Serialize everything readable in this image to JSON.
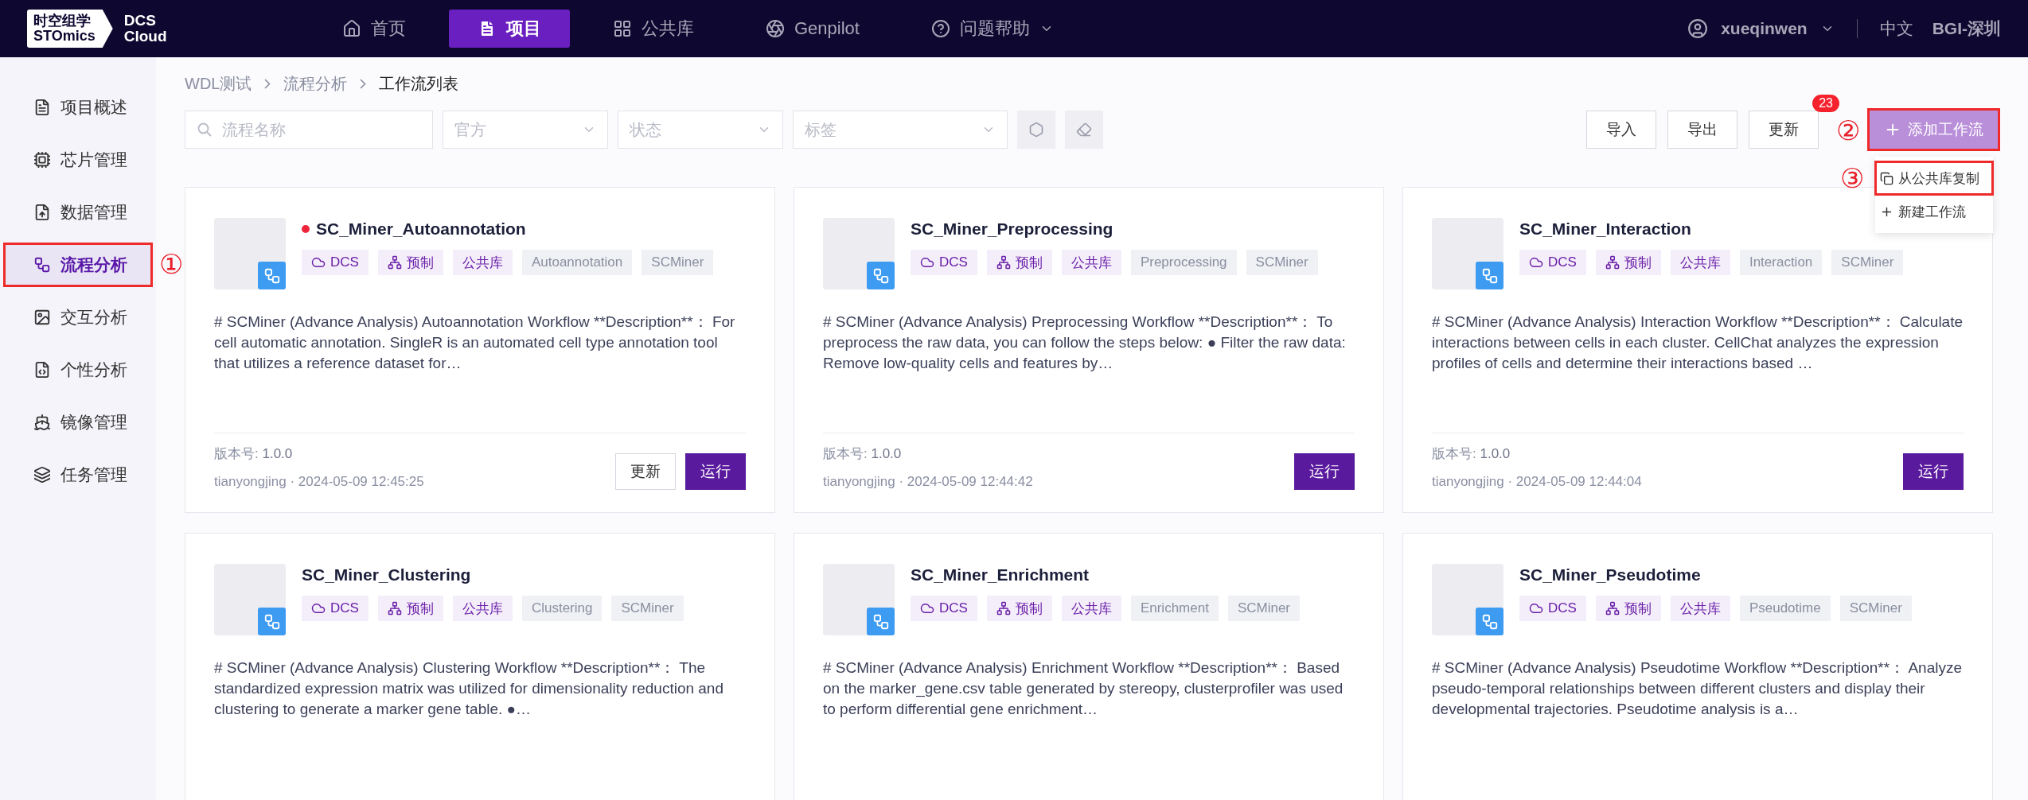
{
  "header": {
    "logo": {
      "brand_line1": "时空组学",
      "brand_line2": "STOmics",
      "product_line1": "DCS",
      "product_line2": "Cloud"
    },
    "nav": [
      {
        "label": "首页",
        "kind": "home",
        "selected": false,
        "dropdown": false
      },
      {
        "label": "项目",
        "kind": "project",
        "selected": true,
        "dropdown": false
      },
      {
        "label": "公共库",
        "kind": "library",
        "selected": false,
        "dropdown": false
      },
      {
        "label": "Genpilot",
        "kind": "genpilot",
        "selected": false,
        "dropdown": false
      },
      {
        "label": "问题帮助",
        "kind": "help",
        "selected": false,
        "dropdown": true
      }
    ],
    "user": "xueqinwen",
    "language": "中文",
    "region": "BGI-深圳"
  },
  "sidebar": {
    "items": [
      {
        "label": "项目概述",
        "kind": "overview",
        "selected": false,
        "highlighted": false
      },
      {
        "label": "芯片管理",
        "kind": "chip",
        "selected": false,
        "highlighted": false
      },
      {
        "label": "数据管理",
        "kind": "data",
        "selected": false,
        "highlighted": false
      },
      {
        "label": "流程分析",
        "kind": "workflow",
        "selected": true,
        "highlighted": true,
        "marker": "①"
      },
      {
        "label": "交互分析",
        "kind": "interactive",
        "selected": false,
        "highlighted": false
      },
      {
        "label": "个性分析",
        "kind": "custom",
        "selected": false,
        "highlighted": false
      },
      {
        "label": "镜像管理",
        "kind": "image",
        "selected": false,
        "highlighted": false
      },
      {
        "label": "任务管理",
        "kind": "task",
        "selected": false,
        "highlighted": false
      }
    ]
  },
  "breadcrumb": [
    "WDL测试",
    "流程分析",
    "工作流列表"
  ],
  "filters": {
    "search": {
      "placeholder": "流程名称"
    },
    "selects": [
      {
        "placeholder": "官方"
      },
      {
        "placeholder": "状态"
      },
      {
        "placeholder": "标签"
      }
    ]
  },
  "actions": [
    {
      "label": "导入"
    },
    {
      "label": "导出"
    },
    {
      "label": "更新",
      "badge": "23"
    }
  ],
  "add_button": {
    "label": "添加工作流",
    "highlighted": true,
    "marker": "②"
  },
  "add_menu": [
    {
      "label": "从公共库复制",
      "kind": "copy",
      "highlighted": true,
      "marker": "③"
    },
    {
      "label": "新建工作流",
      "kind": "new",
      "highlighted": false
    }
  ],
  "cards": [
    {
      "title": "SC_Miner_Autoannotation",
      "status_dot": true,
      "tags": [
        {
          "label": "DCS",
          "kind": "cloud"
        },
        {
          "label": "预制",
          "kind": "preset"
        },
        {
          "label": "公共库",
          "kind": "library"
        },
        {
          "label": "Autoannotation",
          "kind": "plain"
        },
        {
          "label": "SCMiner",
          "kind": "plain"
        }
      ],
      "description": "# SCMiner (Advance Analysis) Autoannotation Workflow **Description**：  For cell automatic annotation. SingleR is an automated cell type annotation tool that utilizes a reference dataset for…",
      "version_label": "版本号:",
      "version": "1.0.0",
      "byline": "tianyongjing · 2024-05-09 12:45:25",
      "buttons": [
        {
          "label": "更新",
          "kind": "secondary"
        },
        {
          "label": "运行",
          "kind": "primary"
        }
      ]
    },
    {
      "title": "SC_Miner_Preprocessing",
      "status_dot": false,
      "tags": [
        {
          "label": "DCS",
          "kind": "cloud"
        },
        {
          "label": "预制",
          "kind": "preset"
        },
        {
          "label": "公共库",
          "kind": "library"
        },
        {
          "label": "Preprocessing",
          "kind": "plain"
        },
        {
          "label": "SCMiner",
          "kind": "plain"
        }
      ],
      "description": "# SCMiner (Advance Analysis) Preprocessing Workflow **Description**：  To preprocess the raw data, you can follow the steps below: ● Filter the raw data: Remove low-quality cells and features by…",
      "version_label": "版本号:",
      "version": "1.0.0",
      "byline": "tianyongjing · 2024-05-09 12:44:42",
      "buttons": [
        {
          "label": "运行",
          "kind": "primary"
        }
      ]
    },
    {
      "title": "SC_Miner_Interaction",
      "status_dot": false,
      "tags": [
        {
          "label": "DCS",
          "kind": "cloud"
        },
        {
          "label": "预制",
          "kind": "preset"
        },
        {
          "label": "公共库",
          "kind": "library"
        },
        {
          "label": "Interaction",
          "kind": "plain"
        },
        {
          "label": "SCMiner",
          "kind": "plain"
        }
      ],
      "description": "# SCMiner (Advance Analysis) Interaction Workflow **Description**： Calculate interactions between cells in each cluster. CellChat analyzes the expression profiles of cells and determine their interactions based …",
      "version_label": "版本号:",
      "version": "1.0.0",
      "byline": "tianyongjing · 2024-05-09 12:44:04",
      "buttons": [
        {
          "label": "运行",
          "kind": "primary"
        }
      ]
    },
    {
      "title": "SC_Miner_Clustering",
      "status_dot": false,
      "tags": [
        {
          "label": "DCS",
          "kind": "cloud"
        },
        {
          "label": "预制",
          "kind": "preset"
        },
        {
          "label": "公共库",
          "kind": "library"
        },
        {
          "label": "Clustering",
          "kind": "plain"
        },
        {
          "label": "SCMiner",
          "kind": "plain"
        }
      ],
      "description": "# SCMiner (Advance Analysis) Clustering Workflow **Description**： The standardized expression matrix was utilized for dimensionality reduction and clustering to generate a marker gene table. ●…"
    },
    {
      "title": "SC_Miner_Enrichment",
      "status_dot": false,
      "tags": [
        {
          "label": "DCS",
          "kind": "cloud"
        },
        {
          "label": "预制",
          "kind": "preset"
        },
        {
          "label": "公共库",
          "kind": "library"
        },
        {
          "label": "Enrichment",
          "kind": "plain"
        },
        {
          "label": "SCMiner",
          "kind": "plain"
        }
      ],
      "description": "# SCMiner (Advance Analysis) Enrichment Workflow **Description**： Based on the marker_gene.csv table generated by stereopy, clusterprofiler was used to perform differential gene enrichment…"
    },
    {
      "title": "SC_Miner_Pseudotime",
      "status_dot": false,
      "tags": [
        {
          "label": "DCS",
          "kind": "cloud"
        },
        {
          "label": "预制",
          "kind": "preset"
        },
        {
          "label": "公共库",
          "kind": "library"
        },
        {
          "label": "Pseudotime",
          "kind": "plain"
        },
        {
          "label": "SCMiner",
          "kind": "plain"
        }
      ],
      "description": "# SCMiner (Advance Analysis) Pseudotime Workflow **Description**： Analyze pseudo-temporal relationships between different clusters and display their developmental trajectories. Pseudotime analysis is a…"
    }
  ]
}
